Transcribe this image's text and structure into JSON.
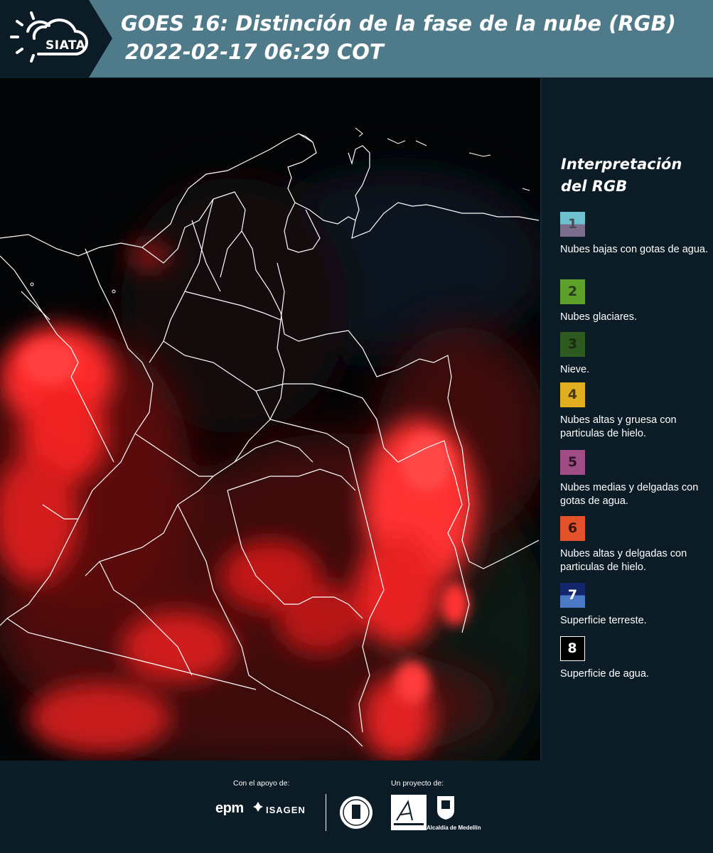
{
  "header": {
    "logo_text": "SIATA",
    "title_line1": "GOES 16: Distinción de la fase de la nube (RGB)",
    "title_line2": "2022-02-17 06:29 COT",
    "colors": {
      "panel": "#4e7a8a",
      "dark": "#0b1c26"
    }
  },
  "legend": {
    "title": "Interpretación del RGB",
    "items": [
      {
        "number": "1",
        "label": "Nubes bajas con gotas de agua.",
        "color_top": "#6fc1cf",
        "color_bottom": "#7b6d8c",
        "text_color": "#4b4b55"
      },
      {
        "number": "2",
        "label": "Nubes glaciares.",
        "color_top": "#5da12b",
        "color_bottom": "#5da12b",
        "text_color": "#2a3a1a"
      },
      {
        "number": "3",
        "label": "Nieve.",
        "color_top": "#2f5a1f",
        "color_bottom": "#2f5a1f",
        "text_color": "#1a2a12"
      },
      {
        "number": "4",
        "label": "Nubes altas y gruesa con particulas de hielo.",
        "color_top": "#e0ae1e",
        "color_bottom": "#e0ae1e",
        "text_color": "#4a3a10"
      },
      {
        "number": "5",
        "label": "Nubes medias y delgadas con gotas de agua.",
        "color_top": "#a04d86",
        "color_bottom": "#a04d86",
        "text_color": "#2a1424"
      },
      {
        "number": "6",
        "label": "Nubes altas y delgadas con particulas de hielo.",
        "color_top": "#e3522b",
        "color_bottom": "#e3522b",
        "text_color": "#3a1409"
      },
      {
        "number": "7",
        "label": "Superficie terreste.",
        "color_top": "#13266b",
        "color_bottom": "#4b79c6",
        "text_color": "#ffffff"
      },
      {
        "number": "8",
        "label": "Superficie de agua.",
        "color_top": "#000000",
        "color_bottom": "#000000",
        "text_color": "#ffffff",
        "border": "#ffffff"
      }
    ]
  },
  "footer": {
    "support_label": "Con el apoyo de:",
    "project_label": "Un proyecto de:",
    "sponsors": [
      "epm",
      "ISAGEN"
    ],
    "partners": [
      "Área Metropolitana Valle de Aburrá",
      "Alcaldía de Medellín"
    ],
    "alcaldia_text": "Alcaldía de Medellín"
  }
}
